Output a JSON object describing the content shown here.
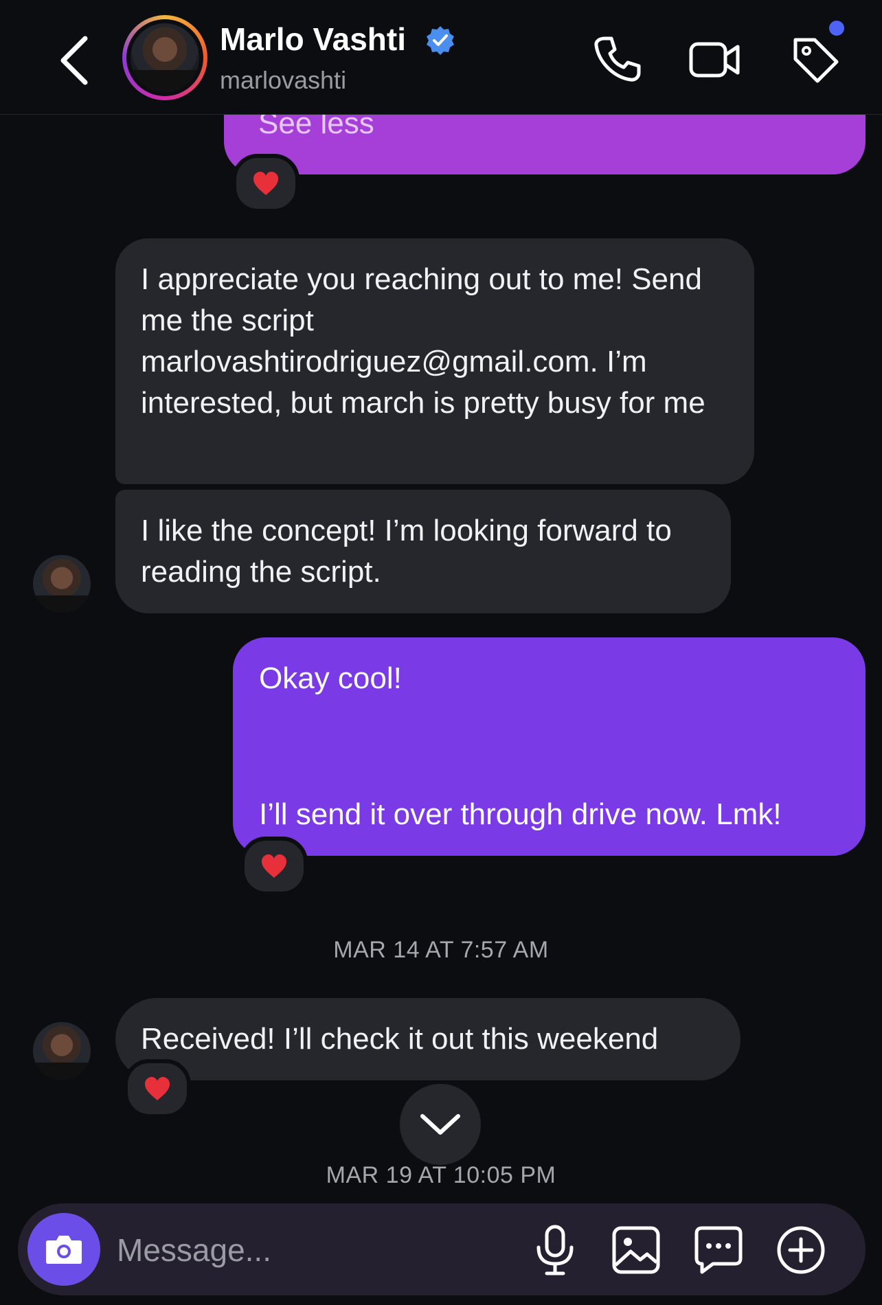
{
  "header": {
    "name": "Marlo Vashti",
    "handle": "marlovashti"
  },
  "messages": {
    "see_less": "See less",
    "recv1": "I appreciate you reaching out to me! Send me the script marlovashtirodriguez@gmail.com. I’m interested, but march is pretty busy for me",
    "recv2": "I like the concept! I’m looking forward to reading the script.",
    "sent_line1": "Okay cool!",
    "sent_line2": "I’ll send it over through drive now. Lmk!",
    "timestamp1": "MAR 14 AT 7:57 AM",
    "recv3": "Received! I’ll check it out this weekend",
    "timestamp2": "MAR 19 AT 10:05 PM"
  },
  "composer": {
    "placeholder": "Message..."
  },
  "colors": {
    "background": "#0c0d11",
    "received_bubble": "#26272d",
    "sent_bubble_top": "#a63fd8",
    "sent_bubble": "#7a3be6",
    "accent_dot": "#4c63f5",
    "camera_button": "#6b4ee8"
  },
  "icons": [
    "back-chevron-icon",
    "verified-badge-icon",
    "phone-icon",
    "video-camera-icon",
    "tag-icon",
    "heart-reaction-icon",
    "chevron-down-icon",
    "camera-icon",
    "microphone-icon",
    "gallery-icon",
    "sticker-chat-icon",
    "plus-circle-icon"
  ]
}
